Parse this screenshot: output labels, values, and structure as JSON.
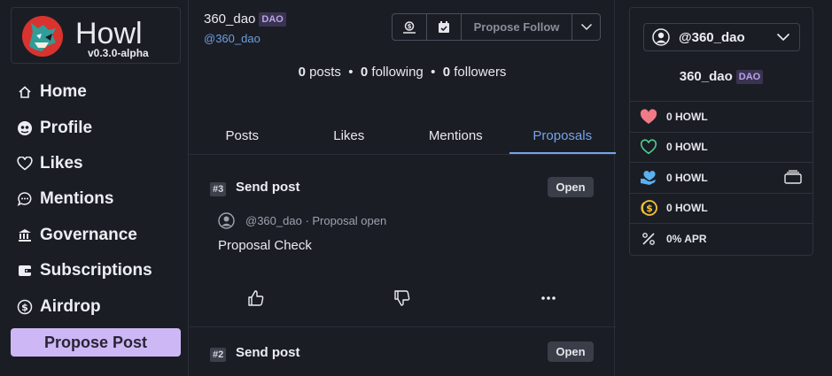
{
  "app": {
    "name": "Howl",
    "version": "v0.3.0-alpha"
  },
  "nav": {
    "items": [
      {
        "label": "Home",
        "icon": "home-icon"
      },
      {
        "label": "Profile",
        "icon": "profile-icon"
      },
      {
        "label": "Likes",
        "icon": "heart-icon"
      },
      {
        "label": "Mentions",
        "icon": "chat-icon"
      },
      {
        "label": "Governance",
        "icon": "bank-icon"
      },
      {
        "label": "Subscriptions",
        "icon": "wallet-icon"
      },
      {
        "label": "Airdrop",
        "icon": "coin-icon"
      }
    ],
    "propose_post": "Propose Post"
  },
  "profile": {
    "name": "360_dao",
    "badge": "DAO",
    "handle": "@360_dao",
    "propose_follow": "Propose Follow",
    "stats": {
      "posts_count": "0",
      "posts_label": "posts",
      "following_count": "0",
      "following_label": "following",
      "followers_count": "0",
      "followers_label": "followers",
      "sep": "•"
    }
  },
  "tabs": [
    {
      "label": "Posts"
    },
    {
      "label": "Likes"
    },
    {
      "label": "Mentions"
    },
    {
      "label": "Proposals",
      "active": true
    }
  ],
  "proposals": [
    {
      "num": "#3",
      "title": "Send post",
      "status": "Open",
      "author": "@360_dao",
      "meta": "· Proposal open",
      "body": "Proposal Check"
    },
    {
      "num": "#2",
      "title": "Send post",
      "status": "Open"
    }
  ],
  "account": {
    "handle": "@360_dao",
    "name": "360_dao",
    "badge": "DAO",
    "rows": [
      {
        "icon": "heart-filled-icon",
        "text": "0 HOWL",
        "color": "#f07b87"
      },
      {
        "icon": "heart-outline-icon",
        "text": "0 HOWL",
        "color": "#4fd089"
      },
      {
        "icon": "heart-hand-icon",
        "text": "0 HOWL",
        "color": "#5ab0f0"
      },
      {
        "icon": "coins-icon",
        "text": "0 HOWL",
        "color": "#f2c230"
      },
      {
        "icon": "percent-icon",
        "text": "0% APR"
      }
    ]
  },
  "colors": {
    "accent": "#75a3e6",
    "propose_post_bg": "#cdb8f5",
    "background": "#1b1d25"
  }
}
